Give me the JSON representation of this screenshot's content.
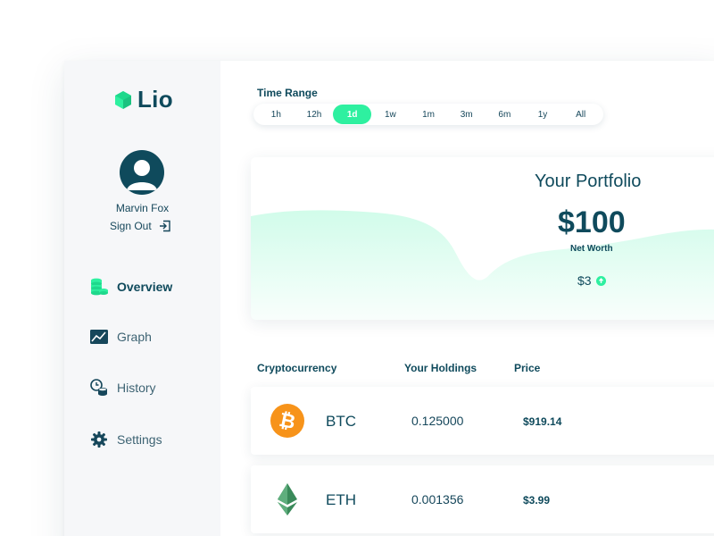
{
  "brand": {
    "name": "Lio",
    "accent": "#2ef0a0",
    "primary": "#0f4a5c"
  },
  "user": {
    "name": "Marvin Fox",
    "sign_out_label": "Sign Out"
  },
  "nav": {
    "items": [
      {
        "label": "Overview",
        "icon": "coins-stack-icon",
        "active": true
      },
      {
        "label": "Graph",
        "icon": "chart-image-icon",
        "active": false
      },
      {
        "label": "History",
        "icon": "coins-history-icon",
        "active": false
      },
      {
        "label": "Settings",
        "icon": "gear-icon",
        "active": false
      }
    ]
  },
  "time_range": {
    "label": "Time Range",
    "options": [
      "1h",
      "12h",
      "1d",
      "1w",
      "1m",
      "3m",
      "6m",
      "1y",
      "All"
    ],
    "selected": "1d"
  },
  "portfolio": {
    "title": "Your Portfolio",
    "value": "$100",
    "subtitle": "Net Worth",
    "change": "$3",
    "change_direction": "up"
  },
  "table": {
    "headers": {
      "crypto": "Cryptocurrency",
      "holdings": "Your Holdings",
      "price": "Price"
    },
    "rows": [
      {
        "symbol": "BTC",
        "icon": "bitcoin-icon",
        "holdings": "0.125000",
        "price": "$919.14"
      },
      {
        "symbol": "ETH",
        "icon": "ethereum-icon",
        "holdings": "0.001356",
        "price": "$3.99"
      }
    ]
  }
}
